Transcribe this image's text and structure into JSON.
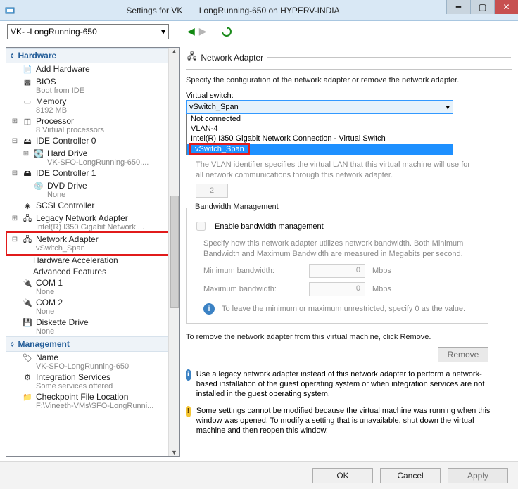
{
  "window": {
    "title": "Settings for VK       LongRunning-650 on HYPERV-INDIA"
  },
  "combo": {
    "value": "VK-      -LongRunning-650"
  },
  "sidebar": {
    "sections": {
      "hardware": "Hardware",
      "management": "Management"
    },
    "items": [
      {
        "label": "Add Hardware",
        "sub": ""
      },
      {
        "label": "BIOS",
        "sub": "Boot from IDE"
      },
      {
        "label": "Memory",
        "sub": "8192 MB"
      },
      {
        "label": "Processor",
        "sub": "8 Virtual processors"
      },
      {
        "label": "IDE Controller 0",
        "sub": ""
      },
      {
        "label": "Hard Drive",
        "sub": "VK-SFO-LongRunning-650...."
      },
      {
        "label": "IDE Controller 1",
        "sub": ""
      },
      {
        "label": "DVD Drive",
        "sub": "None"
      },
      {
        "label": "SCSI Controller",
        "sub": ""
      },
      {
        "label": "Legacy Network Adapter",
        "sub": "Intel(R) I350 Gigabit Network ..."
      },
      {
        "label": "Network Adapter",
        "sub": "vSwitch_Span"
      },
      {
        "label": "Hardware Acceleration",
        "sub": ""
      },
      {
        "label": "Advanced Features",
        "sub": ""
      },
      {
        "label": "COM 1",
        "sub": "None"
      },
      {
        "label": "COM 2",
        "sub": "None"
      },
      {
        "label": "Diskette Drive",
        "sub": "None"
      },
      {
        "label": "Name",
        "sub": "VK-SFO-LongRunning-650"
      },
      {
        "label": "Integration Services",
        "sub": "Some services offered"
      },
      {
        "label": "Checkpoint File Location",
        "sub": "F:\\Vineeth-VMs\\SFO-LongRunni..."
      }
    ]
  },
  "content": {
    "header": "Network Adapter",
    "desc": "Specify the configuration of the network adapter or remove the network adapter.",
    "vswitch": {
      "label": "Virtual switch:",
      "value": "vSwitch_Span",
      "options": [
        "Not connected",
        "VLAN-4",
        "Intel(R) I350 Gigabit Network Connection - Virtual Switch",
        "vSwitch_Span"
      ]
    },
    "vlan": {
      "desc": "The VLAN identifier specifies the virtual LAN that this virtual machine will use for all network communications through this network adapter.",
      "value": "2"
    },
    "bandwidth": {
      "title": "Bandwidth Management",
      "checkbox": "Enable bandwidth management",
      "desc": "Specify how this network adapter utilizes network bandwidth. Both Minimum Bandwidth and Maximum Bandwidth are measured in Megabits per second.",
      "min_label": "Minimum bandwidth:",
      "max_label": "Maximum bandwidth:",
      "min_val": "0",
      "max_val": "0",
      "unit": "Mbps",
      "hint": "To leave the minimum or maximum unrestricted, specify 0 as the value."
    },
    "remove": {
      "text": "To remove the network adapter from this virtual machine, click Remove.",
      "btn": "Remove"
    },
    "note_info": "Use a legacy network adapter instead of this network adapter to perform a network-based installation of the guest operating system or when integration services are not installed in the guest operating system.",
    "note_warn": "Some settings cannot be modified because the virtual machine was running when this window was opened. To modify a setting that is unavailable, shut down the virtual machine and then reopen this window."
  },
  "footer": {
    "ok": "OK",
    "cancel": "Cancel",
    "apply": "Apply"
  }
}
